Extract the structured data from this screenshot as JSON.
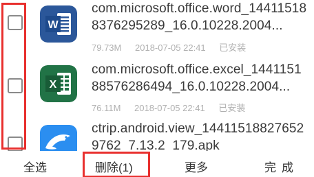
{
  "files": [
    {
      "name": "com.microsoft.office.word_144115188376295289_16.0.10228.2004...",
      "size": "79.73M",
      "date": "2018-07-05 22:41",
      "status": "已安装",
      "icon": "word-icon",
      "checked": false
    },
    {
      "name": "com.microsoft.office.excel_144115188576286494_16.0.10228.2004...",
      "size": "76.11M",
      "date": "2018-07-05 22:41",
      "status": "已安装",
      "icon": "excel-icon",
      "checked": false
    },
    {
      "name": "ctrip.android.view_144115188276529762_7.13.2_179.apk",
      "icon": "dolphin-icon",
      "checked": false
    }
  ],
  "toolbar": {
    "select_all": "全选",
    "delete": "删除(1)",
    "more": "更多",
    "done": "完成"
  },
  "colors": {
    "highlight": "#e8302e",
    "word_blue": "#2b579a",
    "excel_green": "#217346",
    "ctrip_blue": "#2b8ef0",
    "meta_gray": "#b0b0b0"
  }
}
